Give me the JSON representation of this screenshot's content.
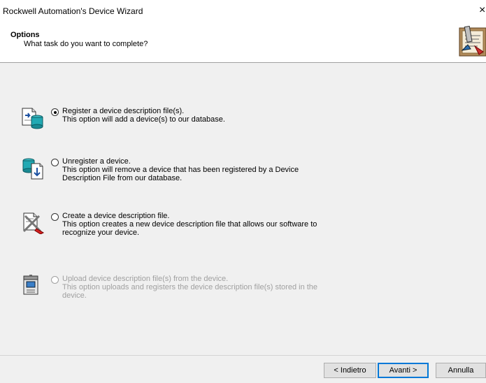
{
  "window": {
    "title": "Rockwell Automation's Device Wizard",
    "close_glyph": "×"
  },
  "header": {
    "title": "Options",
    "subtitle": "What task do you want to complete?",
    "icon": "wizard-document-icon"
  },
  "options": [
    {
      "icon": "register-database-icon",
      "line1": "Register a device description file(s).",
      "line2": "This option will add a device(s) to our database.",
      "selected": true,
      "enabled": true
    },
    {
      "icon": "unregister-database-icon",
      "line1": "Unregister a device.",
      "line2": "This option will remove a device that has been registered by a Device Description File from our database.",
      "selected": false,
      "enabled": true
    },
    {
      "icon": "create-file-tools-icon",
      "line1": "Create a device description file.",
      "line2": "This option creates a new device description file that allows our software to recognize your device.",
      "selected": false,
      "enabled": true
    },
    {
      "icon": "upload-device-icon",
      "line1": "Upload device description file(s) from the device.",
      "line2": "This option uploads and registers the device description file(s) stored in the device.",
      "selected": false,
      "enabled": false
    }
  ],
  "buttons": {
    "back": "< Indietro",
    "next": "Avanti >",
    "cancel": "Annulla"
  },
  "colors": {
    "background": "#f0f0f0",
    "header_bg": "#ffffff",
    "disabled_text": "#a0a0a0",
    "default_button_border": "#0078d7"
  }
}
